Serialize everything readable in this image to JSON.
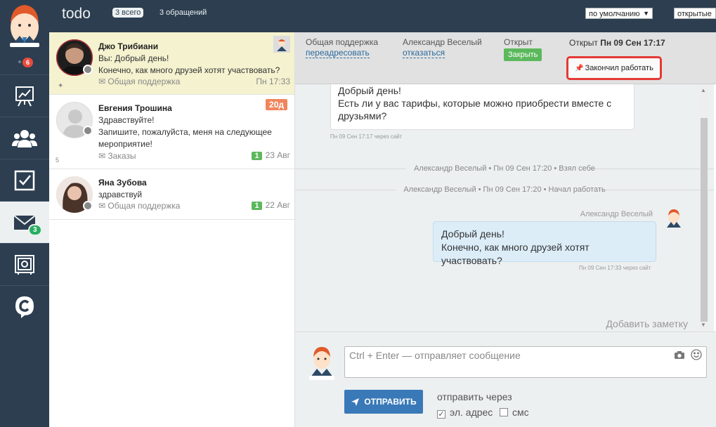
{
  "topbar": {
    "title": "todo",
    "filter_pill": "3 всего",
    "count_link": "3 обращений",
    "sort_select": "по умолчанию",
    "status_select": "открытые"
  },
  "rail": {
    "notif_badge": "6",
    "mail_badge": "3"
  },
  "conversations": [
    {
      "name": "Джо Трибиани",
      "line1": "Вы: Добрый день!",
      "line2": "Конечно, как много друзей хотят участвовать?",
      "tag": "Общая поддержка",
      "date": "Пн 17:33"
    },
    {
      "name": "Евгения Трошина",
      "line1": "Здравствуйте!",
      "line2": "Запишите, пожалуйста, меня на следующее мероприятие!",
      "tag": "Заказы",
      "badge": "1",
      "date": "23 Авг",
      "age": "20д",
      "count": "5"
    },
    {
      "name": "Яна Зубова",
      "line1": "здравствуй",
      "tag": "Общая поддержка",
      "badge": "1",
      "date": "22 Авг"
    }
  ],
  "header": {
    "group_label": "Общая поддержка",
    "group_action": "переадресовать",
    "agent_label": "Александр Веселый",
    "agent_action": "отказаться",
    "status_label": "Открыт",
    "close_button": "Закрыть",
    "opened_prefix": "Открыт",
    "opened_date": "Пн 09 Сен 17:17",
    "finish_button": "Закончил работать"
  },
  "messages": {
    "incoming": {
      "line1": "Добрый день!",
      "line2": "Есть ли у вас тарифы, которые можно приобрести вместе с",
      "line3": "друзьями?",
      "meta": "Пн 09 Сен 17:17 через сайт"
    },
    "system1": "Александр Веселый • Пн 09 Сен 17:20 • Взял себе",
    "system2": "Александр Веселый • Пн 09 Сен 17:20 • Начал работать",
    "outgoing": {
      "author": "Александр Веселый",
      "line1": "Добрый день!",
      "line2": "Конечно, как много друзей хотят участвовать?",
      "meta": "Пн 09 Сен 17:33 через сайт"
    },
    "add_note": "Добавить заметку"
  },
  "composer": {
    "placeholder": "Ctrl + Enter — отправляет сообщение",
    "send_button": "ОТПРАВИТЬ",
    "via_label": "отправить через",
    "option_email": "эл. адрес",
    "option_sms": "смс"
  }
}
